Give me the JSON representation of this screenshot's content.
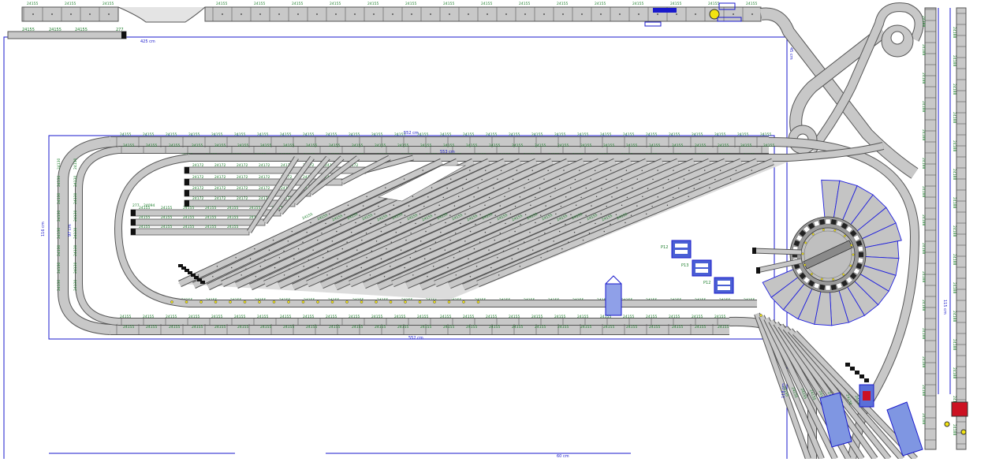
{
  "colors": {
    "track_fill": "#c8c8c8",
    "track_edge": "#555555",
    "tie": "#333333",
    "label_green": "#1b7d2a",
    "dim_blue": "#1a1acc",
    "turntable_fill": "#bfbfbf",
    "sector_fill": "#c4c4c4",
    "sector_edge": "#2020dd",
    "signal_red": "#cc1122",
    "lamp_yellow": "#f2e311",
    "buffer_black": "#111111"
  },
  "labels": {
    "part_straight": "24155",
    "part_short": "24172",
    "part_buffer": "277",
    "part_short2": "24094",
    "part_curve": "24130",
    "part_switch": "24612",
    "part_vert": "24188",
    "dim_top": "552 cm",
    "dim_top2": "553 cm",
    "dim_bottom": "552 cm",
    "dim_left": "116 cm",
    "dim_left_inner": "97 cm",
    "dim_right_top": "45 cm",
    "dim_right_mid": "115 cm",
    "dim_right_low": "118 cm",
    "dim_top_left": "425 cm",
    "dim_bottom_small": "60 cm",
    "box_1": "P12",
    "box_2": "P13",
    "box_3": "P12"
  },
  "icons": [
    "buffer-stop-icon",
    "signal-lamp-icon",
    "turntable-icon",
    "accessory-box-icon",
    "signal-mast-icon"
  ]
}
